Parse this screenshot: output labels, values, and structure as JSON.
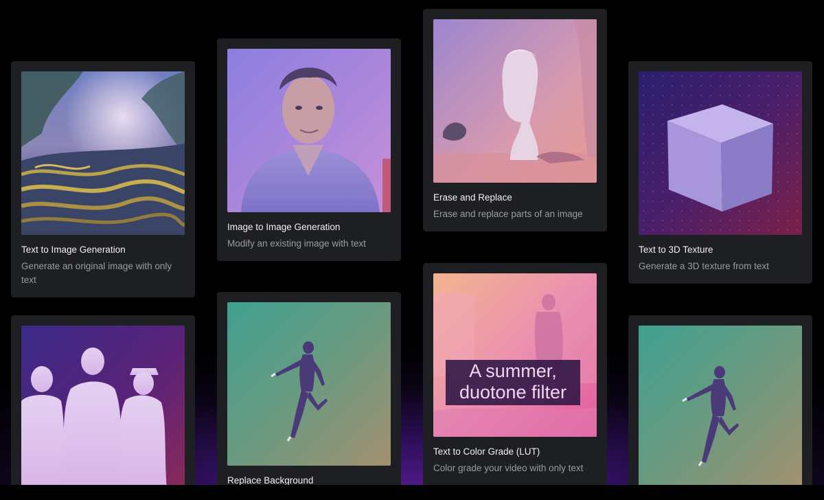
{
  "cards": [
    {
      "title": "Text to Image Generation",
      "description": "Generate an original image with only text",
      "thumbnail": "mossy-forest-landscape"
    },
    {
      "title": "Image to Image Generation",
      "description": "Modify an existing image with text",
      "thumbnail": "man-portrait"
    },
    {
      "title": "Erase and Replace",
      "description": "Erase and replace parts of an image",
      "thumbnail": "greek-bust-statue"
    },
    {
      "title": "Text to 3D Texture",
      "description": "Generate a 3D texture from text",
      "thumbnail": "3d-cube"
    },
    {
      "title": "",
      "description": "",
      "thumbnail": "people-silhouettes"
    },
    {
      "title": "Replace Background",
      "description": "",
      "thumbnail": "dancer-green-background"
    },
    {
      "title": "Text to Color Grade (LUT)",
      "description": "Color grade your video with only text",
      "thumbnail": "duotone-street",
      "overlay_text": "A summer, duotone filter"
    },
    {
      "title": "",
      "description": "",
      "thumbnail": "dancer-green-background"
    }
  ],
  "colors": {
    "background": "#000000",
    "card_background": "#1d1f23",
    "title_text": "#f1f1f3",
    "description_text": "#9a9ca4",
    "bottom_glow": "#5a1c96"
  }
}
